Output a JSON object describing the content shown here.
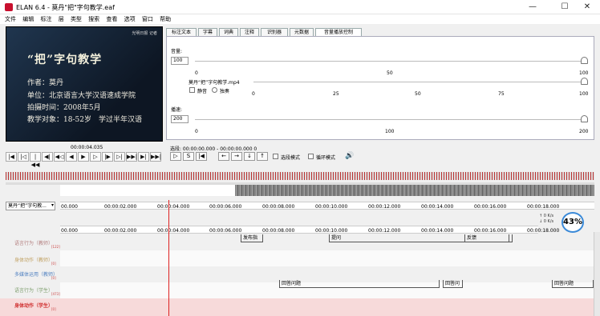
{
  "window": {
    "title": "ELAN 6.4 - 莫丹\"把\"字句教学.eaf",
    "minimize": "—",
    "maximize": "☐",
    "close": "✕"
  },
  "menu": [
    "文件",
    "编辑",
    "标注",
    "层",
    "类型",
    "搜索",
    "查看",
    "选项",
    "窗口",
    "帮助"
  ],
  "video": {
    "corner_text": "光明日报 记者",
    "title": "“把”字句教学",
    "lines": [
      "作者：莫丹",
      "单位：北京语言大学汉语速成学院",
      "拍摄时间：2008年5月",
      "教学对象：18-52岁　学过半年汉语"
    ]
  },
  "timecode": "00:00:04.035",
  "transport_icons": [
    "|◀",
    "|◁",
    "|◀◀",
    "◀|",
    "◀◁",
    "◀",
    "▶",
    "▷",
    "|▶",
    "▷|",
    "▶▶|",
    "▶|",
    "▶▶|"
  ],
  "selection": {
    "label": "选段: 00:00:00.000 - 00:00:00.000  0",
    "mode_selection": "选段模式",
    "mode_loop": "循环模式"
  },
  "play_controls": [
    "▷",
    "S",
    "|◀",
    "←",
    "→",
    "↓",
    "↑"
  ],
  "tabs": [
    "标注文本",
    "字幕",
    "词典",
    "注释",
    "识别器",
    "元数据",
    "音量播放控制"
  ],
  "volume": {
    "label": "音量:",
    "value": "100",
    "ticks": [
      "0",
      "50",
      "100"
    ]
  },
  "track": {
    "file": "莫丹“把”字句教学.mp4",
    "mute": "静音",
    "solo": "独奏",
    "ticks": [
      "0",
      "25",
      "50",
      "75",
      "100"
    ]
  },
  "rate": {
    "label": "播速:",
    "value": "200",
    "ticks": [
      "0",
      "100",
      "200"
    ]
  },
  "tier_selector": "莫丹“把”字句教...",
  "ruler_ticks": [
    "00.000",
    "00:00:02.000",
    "00:00:04.000",
    "00:00:06.000",
    "00:00:08.000",
    "00:00:10.000",
    "00:00:12.000",
    "00:00:14.000",
    "00:00:16.000",
    "00:00:18.000"
  ],
  "ruler2_ticks": [
    "00.000",
    "00:00:02.000",
    "00:00:04.000",
    "00:00:06.000",
    "00:00:08.000",
    "00:00:10.000",
    "00:00:12.000",
    "00:00:14.000",
    "00:00:16.000",
    "00:00:18.000"
  ],
  "tiers": [
    {
      "name": "语言行为（教师）",
      "count": "[122]",
      "color": "#b48080"
    },
    {
      "name": "身体动作（教师）",
      "count": "[0]",
      "color": "#c0a060"
    },
    {
      "name": "多媒体运用（教师）",
      "count": "[0]",
      "color": "#5080c0"
    },
    {
      "name": "语言行为（学生）",
      "count": "[473]",
      "color": "#80a070"
    },
    {
      "name": "身体动作（学生）",
      "count": "[0]",
      "color": "#d03030"
    }
  ],
  "annotations": {
    "t1": [
      "发布指",
      "提问",
      "反馈"
    ],
    "t4": [
      "回答问题",
      "回答问",
      "回答问题"
    ]
  },
  "zoom": {
    "percent": "43%",
    "up": "↑ 0  K/s",
    "down": "↓ 0  K/s"
  }
}
